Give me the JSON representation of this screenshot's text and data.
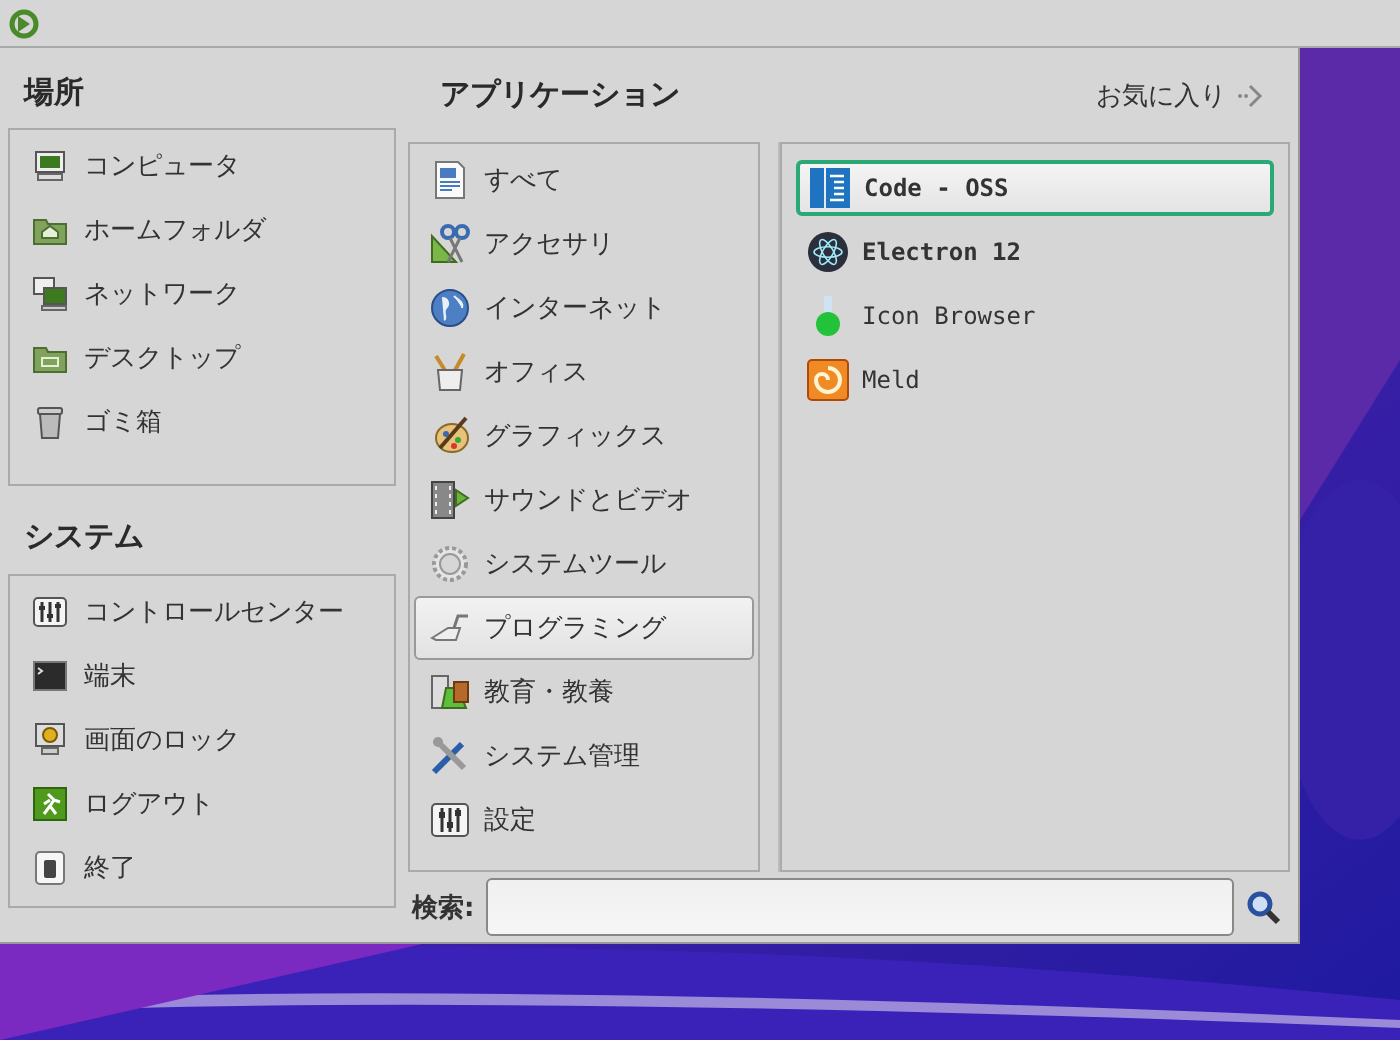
{
  "places": {
    "title": "場所",
    "items": [
      {
        "label": "コンピュータ"
      },
      {
        "label": "ホームフォルダ"
      },
      {
        "label": "ネットワーク"
      },
      {
        "label": "デスクトップ"
      },
      {
        "label": "ゴミ箱"
      }
    ]
  },
  "system": {
    "title": "システム",
    "items": [
      {
        "label": "コントロールセンター"
      },
      {
        "label": "端末"
      },
      {
        "label": "画面のロック"
      },
      {
        "label": "ログアウト"
      },
      {
        "label": "終了"
      }
    ]
  },
  "applications": {
    "title": "アプリケーション",
    "categories": [
      {
        "label": "すべて",
        "selected": false
      },
      {
        "label": "アクセサリ",
        "selected": false
      },
      {
        "label": "インターネット",
        "selected": false
      },
      {
        "label": "オフィス",
        "selected": false
      },
      {
        "label": "グラフィックス",
        "selected": false
      },
      {
        "label": "サウンドとビデオ",
        "selected": false
      },
      {
        "label": "システムツール",
        "selected": false
      },
      {
        "label": "プログラミング",
        "selected": true
      },
      {
        "label": "教育・教養",
        "selected": false
      },
      {
        "label": "システム管理",
        "selected": false
      },
      {
        "label": "設定",
        "selected": false
      }
    ]
  },
  "favorites_link": {
    "label": "お気に入り"
  },
  "apps": [
    {
      "label": "Code - OSS",
      "selected": true,
      "new": true
    },
    {
      "label": "Electron 12",
      "selected": false,
      "new": true
    },
    {
      "label": "Icon Browser",
      "selected": false,
      "new": false
    },
    {
      "label": "Meld",
      "selected": false,
      "new": false
    }
  ],
  "search": {
    "label": "検索:"
  }
}
